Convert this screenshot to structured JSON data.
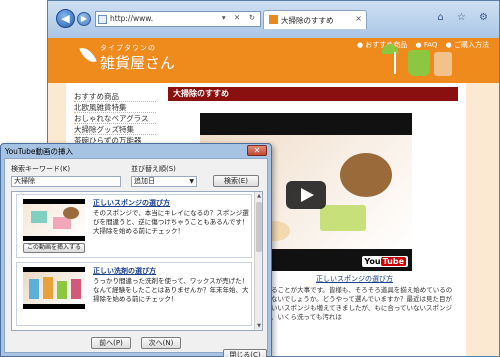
{
  "browser": {
    "url": "http://www.",
    "tab_title": "大掃除のすすめ",
    "tab_close": "×",
    "back": "◀",
    "forward": "▶",
    "addr_buttons": "▾ ✕ ↻",
    "toolbar_icons": "⌂ ☆ ⚙"
  },
  "site": {
    "logo_sub": "タイプタウンの",
    "logo_title": "雑貨屋さん",
    "header_links": [
      "● おすすめ商品",
      "● FAQ",
      "● ご購入方法"
    ],
    "menu": [
      "おすすめ商品",
      "北欧風雑貨特集",
      "おしゃれなベアグラス",
      "大掃除グッズ特集",
      "茶碗ひらずの万能器"
    ],
    "article_heading": "大掃除のすすめ",
    "video_caption": "正しいスポンジの選び方",
    "article_text": "にすることが大事です。皆様も、そろそろ道具を揃え始めているのではないでしょうか。どうやって選んでいますか？最近は見た目がかわいいスポンジも増えてきましたが、もに合っていないスポンジでは、いくら洗っても汚れは",
    "yt_you": "You",
    "yt_tube": "Tube"
  },
  "dialog": {
    "title": "YouTube動画の挿入",
    "close": "✕",
    "keyword_label": "検索キーワード(K)",
    "keyword_value": "大掃除",
    "sort_label": "並び替え順(S)",
    "sort_value": "追加日",
    "search_button": "検索(E)",
    "results": [
      {
        "title": "正しいスポンジの選び方",
        "desc": "そのスポンジで、本当にキレイになるの？スポンジ選びを間違うと、逆に傷つけちゃうこともあるんです！大掃除を始める前にチェック！",
        "insert": "この動画を挿入する"
      },
      {
        "title": "正しい洗剤の選び方",
        "desc": "うっかり間違った洗剤を使って、ワックスが売げた！なんて経験をしたことはありませんか？年末年始、大掃除を始める前にチェック！",
        "insert": ""
      }
    ],
    "prev_button": "前へ(P)",
    "next_button": "次へ(N)",
    "close_button": "閉じる(C)"
  },
  "colors": {
    "header_orange": "#ef8a1d",
    "heading_red": "#8a1010",
    "link_blue": "#1a3f8c"
  }
}
